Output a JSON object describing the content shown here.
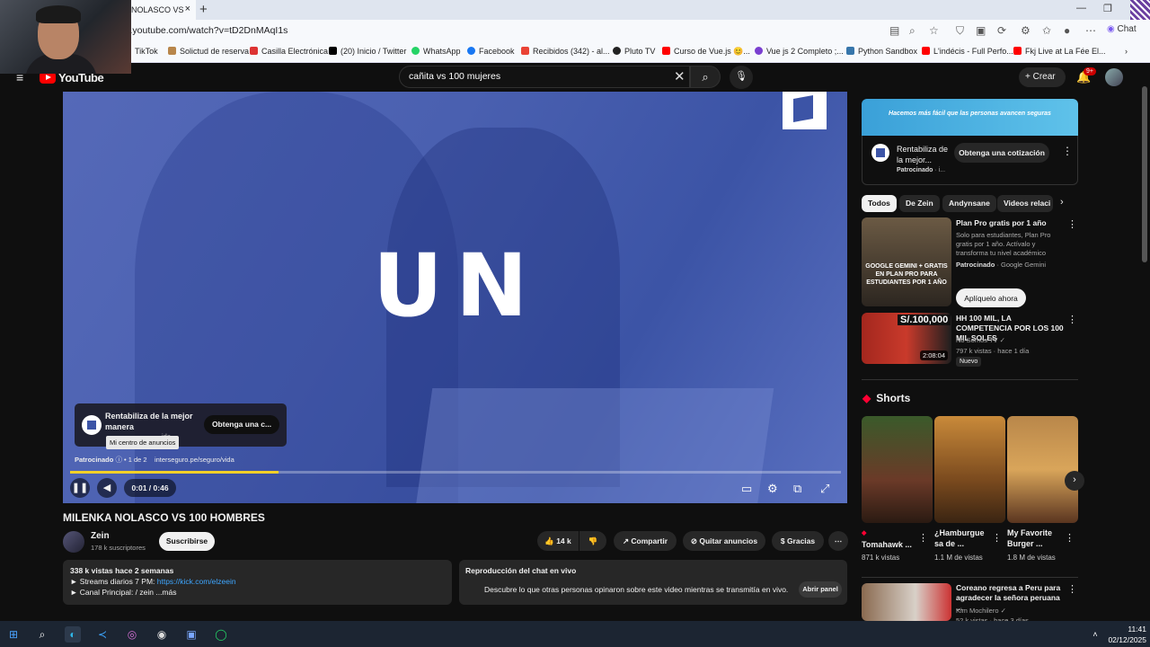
{
  "browser": {
    "tab_title": "NOLASCO VS",
    "tab_close": "×",
    "new_tab": "+",
    "url": "v.youtube.com/watch?v=tD2DnMAqI1s",
    "chat_label": "Chat",
    "bookmarks": [
      {
        "label": "TikTok",
        "color": "#000000"
      },
      {
        "label": "Solictud de reserva",
        "color": "#b8864b"
      },
      {
        "label": "Casilla Electrónica",
        "color": "#d33"
      },
      {
        "label": "(20) Inicio / Twitter",
        "color": "#000000"
      },
      {
        "label": "WhatsApp",
        "color": "#25d366"
      },
      {
        "label": "Facebook",
        "color": "#1877f2"
      },
      {
        "label": "Recibidos (342) - al...",
        "color": "#ea4335"
      },
      {
        "label": "Pluto TV",
        "color": "#222"
      },
      {
        "label": "Curso de Vue.js 😊...",
        "color": "#ff0000"
      },
      {
        "label": "Vue js 2 Completo ;...",
        "color": "#7a3fd0"
      },
      {
        "label": "Python Sandbox",
        "color": "#3776ab"
      },
      {
        "label": "L'indécis - Full Perfo...",
        "color": "#ff0000"
      },
      {
        "label": "Fkj Live at La Fée El...",
        "color": "#ff0000"
      }
    ]
  },
  "youtube": {
    "logo_text": "YouTube",
    "search_value": "cañita vs 100 mujeres",
    "create_label": "Crear",
    "notif_count": "9+"
  },
  "video": {
    "overlay_text": "UN",
    "ad_title": "Rentabiliza de la mejor manera",
    "ad_cta": "Obtenga una c...",
    "ad_tooltip": "Mi centro de anuncios",
    "ad_url_behind": "ida",
    "sponsored": "Patrocinado",
    "ad_index": "1 de 2",
    "ad_url": "interseguro.pe/seguro/vida",
    "progress": 0.27,
    "time": "0:01 / 0:46",
    "title": "MILENKA NOLASCO VS 100 HOMBRES",
    "channel": "Zein",
    "subs": "178 k suscriptores",
    "subscribe": "Suscribirse",
    "likes": "14 k",
    "share": "Compartir",
    "remove_ads": "Quitar anuncios",
    "thanks": "Gracias",
    "desc_line1": "338 k vistas  hace 2 semanas",
    "desc_line2_prefix": "► Streams diarios 7 PM: ",
    "desc_link": "https://kick.com/elzeein",
    "desc_line3": "► Canal Principal:  / zein   ...más",
    "chat_title": "Reproducción del chat en vivo",
    "chat_desc": "Descubre lo que otras personas opinaron sobre este video mientras se transmitía en vivo.",
    "chat_button": "Abrir panel"
  },
  "sidebar": {
    "banner_text": "Hacemos más fácil que las personas avancen seguras",
    "ad_title": "Rentabiliza de la mejor...",
    "ad_sponsored": "Patrocinado",
    "ad_sponsored_suffix": "· i...",
    "ad_cta": "Obtenga una cotización",
    "chips": [
      "Todos",
      "De Zein",
      "Andynsane",
      "Videos relaci"
    ],
    "rec1": {
      "title": "Plan Pro gratis por 1 año",
      "desc": "Solo para estudiantes, Plan Pro gratis por 1 año. Actívalo y transforma tu nivel académico",
      "sponsor": "Patrocinado",
      "sponsor_suffix": "· Google Gemini",
      "button": "Aplíquelo ahora",
      "thumb_text": "GOOGLE GEMINI + GRATIS EN PLAN PRO PARA ESTUDIANTES POR 1 AÑO"
    },
    "rec2": {
      "title": "HH 100 MIL, LA COMPETENCIA POR LOS 100 MIL SOLES",
      "channel": "No Somos TV ✓",
      "meta": "797 k vistas · hace 1 día",
      "badge": "Nuevo",
      "price": "S/.100,000",
      "duration": "2:08:04"
    },
    "shorts_title": "Shorts",
    "shorts": [
      {
        "title": "Tomahawk ...",
        "views": "871 k vistas"
      },
      {
        "title": "¿Hamburgue sa de ...",
        "views": "1.1 M de vistas"
      },
      {
        "title": "My Favorite Burger ...",
        "views": "1.8 M de vistas"
      }
    ],
    "rec3": {
      "title": "Coreano regresa a Peru para agradecer la señora peruana ...",
      "channel": "Kim Mochilero ✓",
      "meta": "52 k vistas · hace 3 días"
    }
  },
  "taskbar": {
    "time": "11:41",
    "date": "02/12/2025"
  }
}
